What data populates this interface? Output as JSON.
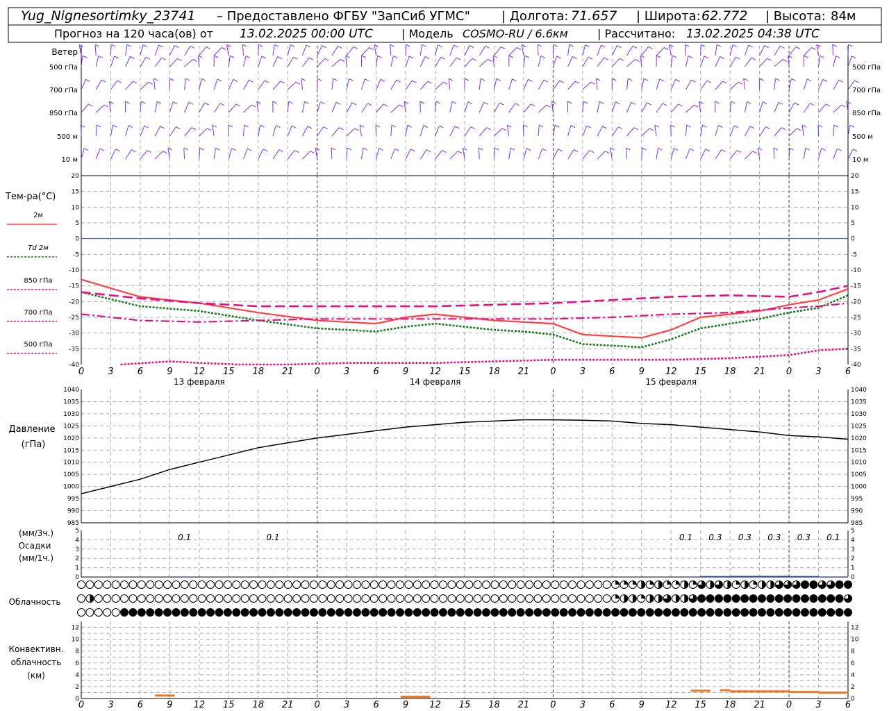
{
  "header": {
    "station": "Yug_Nignesortimky_23741",
    "provided_by": "– Предоставлено ФГБУ \"ЗапСиб УГМС\"",
    "lon_label": "| Долгота:",
    "lon": "71.657",
    "lat_label": "| Широта:",
    "lat": "62.772",
    "alt_label": "| Высота:",
    "alt": "84м",
    "forecast_label": "Прогноз на 120 часа(ов) от",
    "start": "13.02.2025 00:00 UTC",
    "model_label": "| Модель",
    "model": "COSMO-RU / 6.6км",
    "calc_label": "| Рассчитано:",
    "calc": "13.02.2025 04:38 UTC"
  },
  "wind_panel": {
    "title": "Ветер",
    "levels": [
      "500 гПа",
      "700 гПа",
      "850 гПа",
      "500 м",
      "10  м"
    ]
  },
  "temp_panel": {
    "title": "Тем-ра(°С)",
    "legend": [
      {
        "label": "2м",
        "color": "#ff4040",
        "style": "solid"
      },
      {
        "label": "Td  2м",
        "color": "#1a7a1a",
        "style": "dotted"
      },
      {
        "label": "850 гПа",
        "color": "#e0108a",
        "style": "dashed"
      },
      {
        "label": "700 гПа",
        "color": "#e0108a",
        "style": "dashdot"
      },
      {
        "label": "500 гПа",
        "color": "#e0108a",
        "style": "dotted"
      }
    ],
    "yticks": [
      20,
      15,
      10,
      5,
      0,
      -5,
      -10,
      -15,
      -20,
      -25,
      -30,
      -35,
      -40
    ]
  },
  "pressure_panel": {
    "title1": "Давление",
    "title2": "(гПа)",
    "yticks": [
      1040,
      1035,
      1030,
      1025,
      1020,
      1015,
      1010,
      1005,
      1000,
      995,
      990,
      985
    ]
  },
  "precip_panel": {
    "title1": "(мм/3ч.)",
    "title2": "Осадки",
    "title3": "(мм/1ч.)",
    "yticks": [
      5,
      4,
      3,
      2,
      1,
      0
    ]
  },
  "cloud_panel": {
    "title": "Облачность"
  },
  "conv_panel": {
    "title1": "Конвективн.",
    "title2": "облачность",
    "title3": "(км)",
    "yticks": [
      12,
      10,
      8,
      6,
      4,
      2,
      0
    ]
  },
  "xaxis": {
    "hour_labels": [
      "0",
      "3",
      "6",
      "9",
      "12",
      "15",
      "18",
      "21",
      "0",
      "3",
      "6",
      "9",
      "12",
      "15",
      "18",
      "21",
      "0",
      "3",
      "6",
      "9",
      "12",
      "15",
      "18",
      "21",
      "0",
      "3",
      "6"
    ],
    "day_labels": [
      "13 февраля",
      "14 февраля",
      "15 февраля"
    ]
  },
  "chart_data": {
    "type": "line",
    "x_hours": [
      0,
      78
    ],
    "temperature": {
      "ylim": [
        -40,
        20
      ],
      "series": [
        {
          "name": "2м",
          "x": [
            0,
            6,
            12,
            18,
            24,
            27,
            30,
            33,
            36,
            39,
            42,
            45,
            48,
            51,
            54,
            57,
            60,
            63,
            66,
            69,
            72,
            75,
            78
          ],
          "values": [
            -13,
            -18.5,
            -20.5,
            -23.5,
            -26,
            -26.5,
            -27,
            -25,
            -24,
            -25,
            -26,
            -26.5,
            -27,
            -30.5,
            -31,
            -31.5,
            -29,
            -25,
            -24,
            -23,
            -21,
            -19.5,
            -16
          ]
        },
        {
          "name": "Td  2м",
          "x": [
            0,
            6,
            12,
            18,
            24,
            27,
            30,
            33,
            36,
            39,
            42,
            45,
            48,
            51,
            54,
            57,
            60,
            63,
            66,
            69,
            72,
            75,
            78
          ],
          "values": [
            -17,
            -21.5,
            -23,
            -26,
            -28.5,
            -29,
            -29.5,
            -28,
            -27,
            -28,
            -29,
            -29.5,
            -30.5,
            -33.5,
            -34,
            -34.5,
            -32,
            -28.5,
            -27,
            -25.5,
            -23.5,
            -22,
            -18
          ]
        },
        {
          "name": "850 гПа",
          "x": [
            0,
            6,
            12,
            18,
            24,
            30,
            36,
            42,
            48,
            54,
            60,
            66,
            72,
            75,
            78
          ],
          "values": [
            -17,
            -19,
            -20.5,
            -21.5,
            -21.5,
            -21.5,
            -21.5,
            -21,
            -20.5,
            -19.5,
            -18.5,
            -18,
            -18.5,
            -17,
            -15
          ]
        },
        {
          "name": "700 гПа",
          "x": [
            0,
            6,
            12,
            18,
            24,
            30,
            36,
            42,
            48,
            54,
            60,
            66,
            72,
            75,
            78
          ],
          "values": [
            -24,
            -26,
            -26.5,
            -26,
            -25.5,
            -25.5,
            -25.5,
            -25.5,
            -25.5,
            -25,
            -24,
            -23.5,
            -22,
            -21.5,
            -20.5
          ]
        },
        {
          "name": "500 гПа",
          "x": [
            4,
            9,
            12,
            16,
            21,
            27,
            36,
            42,
            48,
            54,
            60,
            66,
            72,
            75,
            78
          ],
          "values": [
            -40,
            -39,
            -39.5,
            -40,
            -40,
            -39.5,
            -39.5,
            -39,
            -38.5,
            -38.5,
            -38.5,
            -38,
            -37,
            -35.5,
            -35
          ]
        }
      ]
    },
    "pressure": {
      "ylim": [
        985,
        1040
      ],
      "x": [
        0,
        3,
        6,
        9,
        12,
        15,
        18,
        21,
        24,
        27,
        30,
        33,
        36,
        39,
        42,
        45,
        48,
        51,
        54,
        57,
        60,
        63,
        66,
        69,
        72,
        75,
        78
      ],
      "values": [
        997,
        1000,
        1003,
        1007,
        1010,
        1013,
        1016,
        1018,
        1020,
        1021.5,
        1023,
        1024.5,
        1025.5,
        1026.5,
        1027,
        1027.5,
        1027.5,
        1027.3,
        1027,
        1026,
        1025.5,
        1024.5,
        1023.5,
        1022.5,
        1021,
        1020.5,
        1019.5
      ]
    },
    "precip": {
      "ylim": [
        0,
        5
      ],
      "labels": [
        {
          "x": 10.5,
          "text": "0.1"
        },
        {
          "x": 19.5,
          "text": "0.1"
        },
        {
          "x": 61.5,
          "text": "0.1"
        },
        {
          "x": 64.5,
          "text": "0.3"
        },
        {
          "x": 67.5,
          "text": "0.3"
        },
        {
          "x": 70.5,
          "text": "0.3"
        },
        {
          "x": 73.5,
          "text": "0.3"
        },
        {
          "x": 76.5,
          "text": "0.1"
        }
      ],
      "bars": [
        [
          9.5,
          11,
          0.05
        ],
        [
          18.5,
          20,
          0.05
        ],
        [
          61,
          63,
          0.05
        ],
        [
          63,
          66,
          0.1
        ],
        [
          66,
          69,
          0.12
        ],
        [
          69,
          72,
          0.12
        ],
        [
          72,
          75,
          0.1
        ],
        [
          75,
          78,
          0.05
        ]
      ]
    },
    "cloud_rows": {
      "high": "000000000000000000000000000000000000000000000000000000000000001112121121323212122333443344",
      "mid": "020000000000000000000000000000000000000000000000000000000000001221223223444444444444444443",
      "low": "000004444444444444444444444444444444444444444444444444444444444444444444444444444444444444"
    },
    "convective": {
      "ylim": [
        0,
        13
      ],
      "segments": [
        [
          7.5,
          9.5,
          0.5
        ],
        [
          32.5,
          35.5,
          0.3
        ],
        [
          62,
          64,
          1.3
        ],
        [
          65,
          66,
          1.4
        ],
        [
          66,
          69,
          1.2
        ],
        [
          69,
          72,
          1.2
        ],
        [
          72,
          75,
          1.1
        ],
        [
          75,
          78,
          1.0
        ]
      ]
    }
  }
}
